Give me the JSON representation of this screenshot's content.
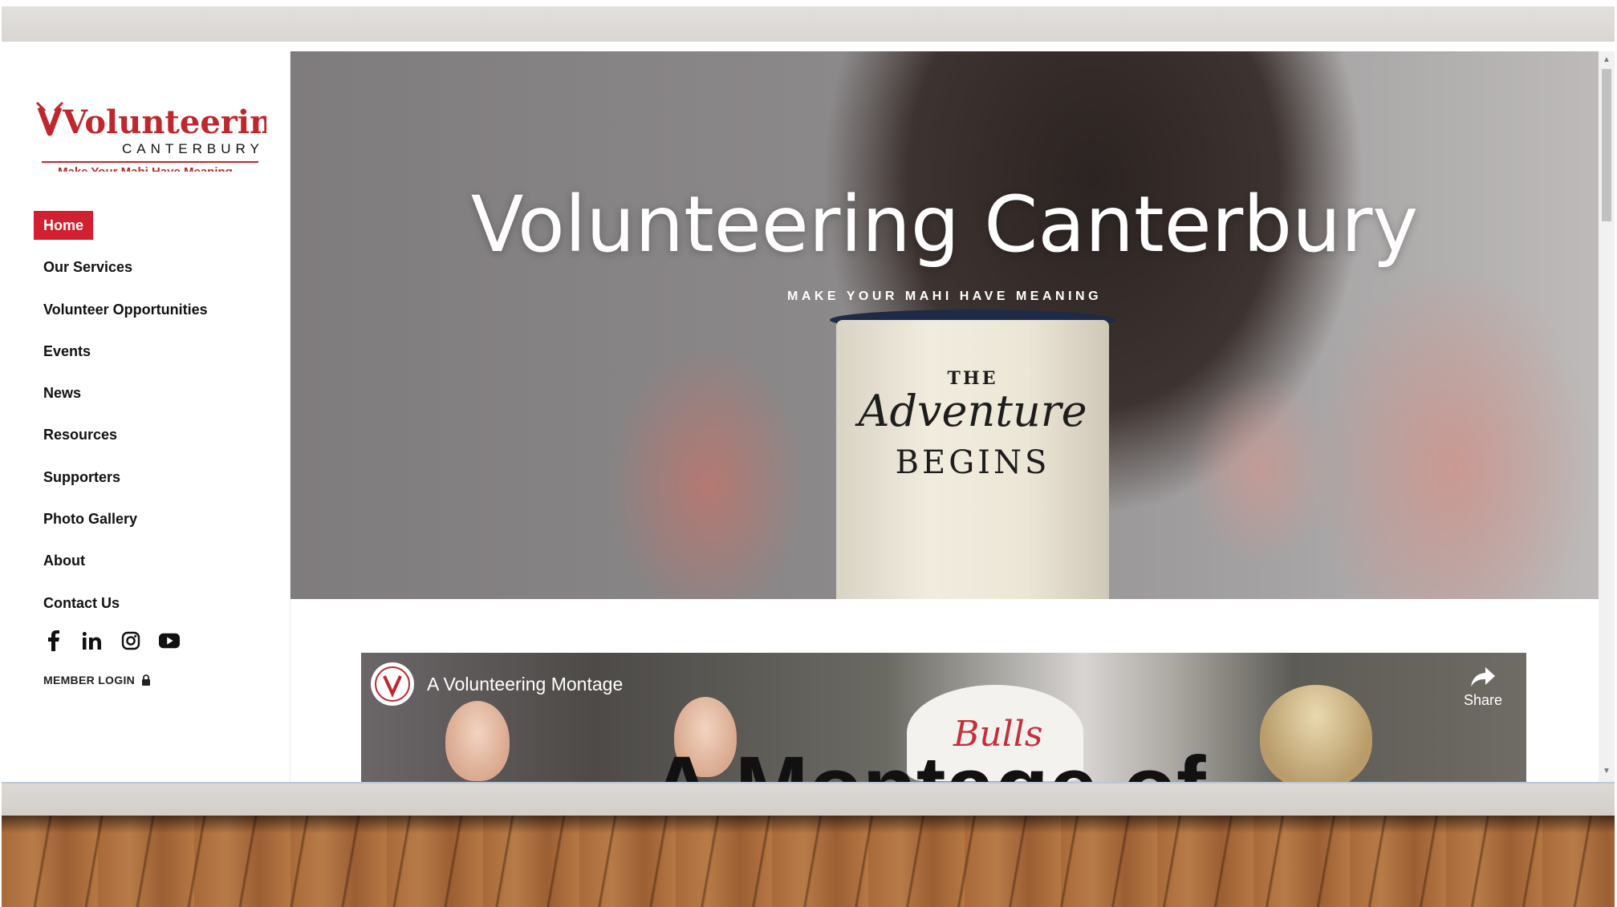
{
  "logo": {
    "brand": "Volunteering",
    "region": "CANTERBURY",
    "tagline": "Make Your Mahi Have Meaning"
  },
  "nav": {
    "items": [
      {
        "label": "Home",
        "active": true
      },
      {
        "label": "Our Services"
      },
      {
        "label": "Volunteer Opportunities"
      },
      {
        "label": "Events"
      },
      {
        "label": "News"
      },
      {
        "label": "Resources"
      },
      {
        "label": "Supporters"
      },
      {
        "label": "Photo Gallery"
      },
      {
        "label": "About"
      },
      {
        "label": "Contact Us"
      }
    ]
  },
  "socials": [
    "facebook-icon",
    "linkedin-icon",
    "instagram-icon",
    "youtube-icon"
  ],
  "member_login": {
    "label": "MEMBER LOGIN",
    "icon": "lock-icon"
  },
  "hero": {
    "title": "Volunteering Canterbury",
    "tagline": "MAKE YOUR MAHI HAVE MEANING",
    "mug": {
      "line1": "THE",
      "line2": "Adventure",
      "line3": "BEGINS"
    }
  },
  "video": {
    "title": "A Volunteering Montage",
    "share_label": "Share",
    "overlay_text": "A Montage of",
    "cap_text": "Bulls"
  },
  "colors": {
    "accent": "#d22030",
    "text": "#111111",
    "hero_text": "#ffffff"
  }
}
